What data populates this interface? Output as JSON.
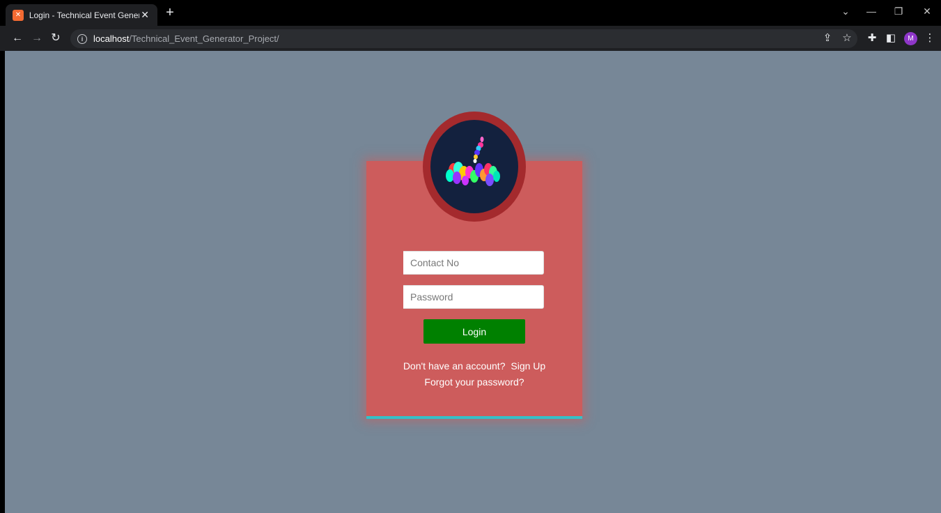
{
  "browser": {
    "tab_title": "Login - Technical Event Generator",
    "tab_favicon": "xampp-icon",
    "url_host": "localhost",
    "url_path": "/Technical_Event_Generator_Project/",
    "avatar_initial": "M"
  },
  "login": {
    "contact_placeholder": "Contact No",
    "password_placeholder": "Password",
    "login_label": "Login",
    "no_account_text": "Don't have an account?",
    "signup_label": "Sign Up",
    "forgot_label": "Forgot your password?"
  },
  "colors": {
    "page_background": "#778797",
    "card_background": "#cd5c5c",
    "addon_accent": "#a42a2d",
    "login_button": "#008000",
    "card_bottom_border": "#35c0c7",
    "logo_background": "#13213e"
  }
}
